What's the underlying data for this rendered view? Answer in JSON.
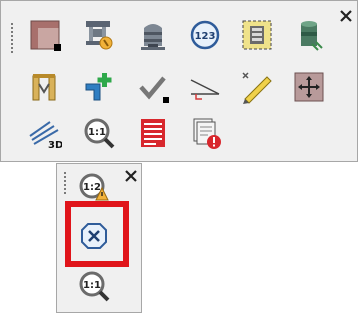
{
  "main_toolbar": {
    "close_icon": "close-icon",
    "rows": [
      [
        "wall-icon",
        "rig-icon",
        "tank-icon",
        "counter-123-icon",
        "frame-select-icon",
        "pipe-cylinder-icon"
      ],
      [
        "columns-icon",
        "pipe-add-icon",
        "check-icon",
        "slope-icon",
        "ruler-edit-icon",
        "move-box-icon"
      ],
      [
        "plane-3d-icon",
        "zoom-1to1-icon",
        "table-report-icon",
        "error-report-icon"
      ]
    ]
  },
  "sub_toolbar": {
    "close_icon": "close-icon",
    "buttons": [
      "scale-warning-icon",
      "cancel-circle-icon",
      "zoom-1to1-icon"
    ],
    "highlighted": "cancel-circle-icon"
  },
  "colors": {
    "toolbar_bg": "#f0f0f0",
    "toolbar_border": "#a7a7a7",
    "highlight": "#e0141a"
  }
}
